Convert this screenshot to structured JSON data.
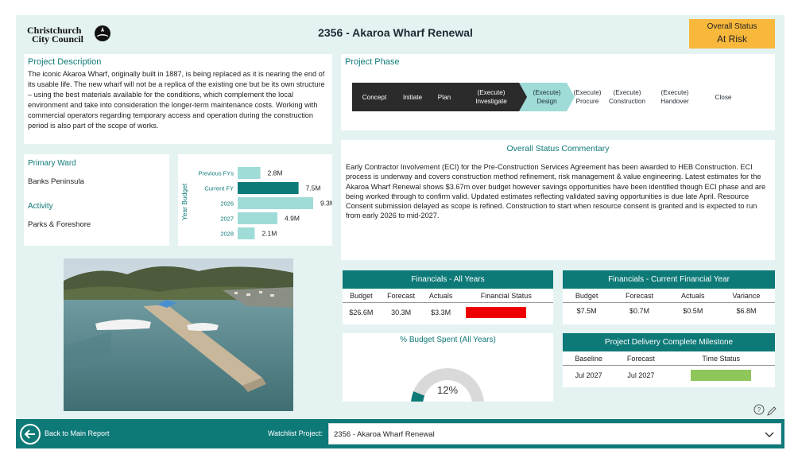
{
  "header": {
    "brand_line1": "Christchurch",
    "brand_line2": "City Council",
    "title": "2356 - Akaroa Wharf Renewal",
    "overall_status_label": "Overall Status",
    "overall_status_value": "At Risk",
    "overall_status_color": "#f8b83c"
  },
  "description": {
    "title": "Project Description",
    "text": "The iconic Akaroa Wharf, originally built in 1887, is being replaced as it is nearing the end of its usable life. The new wharf will not be a replica of the existing one but be its own structure – using the best materials available for the conditions, which complement the local environment and take into consideration the longer-term maintenance costs. Working with commercial operators regarding temporary access and operation during the construction period is also part of the scope of works."
  },
  "phase": {
    "title": "Project Phase",
    "steps": [
      {
        "line1": "Concept",
        "line2": "",
        "state": "done"
      },
      {
        "line1": "Initiate",
        "line2": "",
        "state": "done"
      },
      {
        "line1": "Plan",
        "line2": "",
        "state": "done"
      },
      {
        "line1": "(Execute)",
        "line2": "Investigate",
        "state": "done"
      },
      {
        "line1": "(Execute)",
        "line2": "Design",
        "state": "current"
      },
      {
        "line1": "(Execute)",
        "line2": "Procure",
        "state": "todo"
      },
      {
        "line1": "(Execute)",
        "line2": "Construction",
        "state": "todo"
      },
      {
        "line1": "(Execute)",
        "line2": "Handover",
        "state": "todo"
      },
      {
        "line1": "Close",
        "line2": "",
        "state": "todo"
      }
    ],
    "done_color": "#2b2b2b",
    "current_color": "#9fdcd8"
  },
  "ward": {
    "ward_label": "Primary Ward",
    "ward_value": "Banks Peninsula",
    "activity_label": "Activity",
    "activity_value": "Parks & Foreshore"
  },
  "chart_data": {
    "type": "bar",
    "orientation": "horizontal",
    "title": "",
    "ylabel": "Year Budget",
    "xlabel": "",
    "categories": [
      "Previous FYs",
      "Current FY",
      "2026",
      "2027",
      "2028"
    ],
    "values": [
      2.8,
      7.5,
      9.3,
      4.9,
      2.1
    ],
    "labels": [
      "2.8M",
      "7.5M",
      "9.3M",
      "4.9M",
      "2.1M"
    ],
    "unit": "M",
    "highlight": "Current FY",
    "colors": {
      "bar": "#9fdcd8",
      "highlight": "#0e7a78"
    },
    "grid": false,
    "legend": "none"
  },
  "commentary": {
    "title": "Overall Status Commentary",
    "text": "Early Contractor Involvement (ECI) for the Pre-Construction Services Agreement has been awarded to HEB Construction. ECI process is underway and covers construction method refinement, risk management & value engineering. Latest estimates for the Akaroa Wharf Renewal shows $3.67m over budget however savings opportunities have been identified though ECI phase and are being worked through to confirm valid. Updated estimates reflecting validated saving opportunities is due late April. Resource Consent submission delayed as scope is refined. Construction to start when resource consent is granted and is expected to run from early 2026 to mid-2027."
  },
  "fin_all": {
    "title": "Financials - All Years",
    "headers": [
      "Budget",
      "Forecast",
      "Actuals",
      "Financial Status"
    ],
    "values": [
      "$26.6M",
      "30.3M",
      "$3.3M"
    ],
    "status_color": "#ee0000"
  },
  "fin_current": {
    "title": "Financials - Current Financial Year",
    "headers": [
      "Budget",
      "Forecast",
      "Actuals",
      "Variance"
    ],
    "values": [
      "$7.5M",
      "$0.7M",
      "$0.5M",
      "$6.8M"
    ]
  },
  "spent": {
    "title": "% Budget Spent (All Years)",
    "value": 12,
    "label": "12%",
    "fill_color": "#0e7a78",
    "track_color": "#d9d9d9"
  },
  "milestone": {
    "title": "Project Delivery Complete Milestone",
    "headers": [
      "Baseline",
      "Forecast",
      "Time Status"
    ],
    "values": [
      "Jul 2027",
      "Jul 2027"
    ],
    "status_color": "#8fc65a"
  },
  "footer": {
    "back_label": "Back to Main Report",
    "watchlist_label": "Watchlist Project:",
    "watchlist_value": "2356 - Akaroa Wharf Renewal"
  }
}
